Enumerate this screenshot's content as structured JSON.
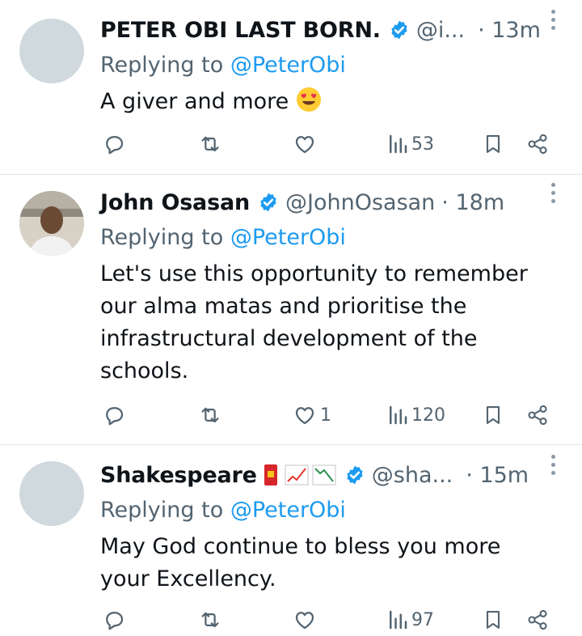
{
  "tweets": [
    {
      "name": "PETER OBI LAST BORN.",
      "handle": "@i...",
      "time": "· 13m",
      "replying_prefix": "Replying to",
      "replying_to": "@PeterObi",
      "text": "A giver and more",
      "emoji": "heart-eyes-emoji",
      "avatar": "placeholder",
      "likes": "",
      "views": "53"
    },
    {
      "name": "John Osasan",
      "handle": "@JohnOsasan",
      "time": "· 18m",
      "replying_prefix": "Replying to",
      "replying_to": "@PeterObi",
      "text": "Let's use this opportunity to remember our alma matas and prioritise the infrastructural development of the schools.",
      "avatar": "photo",
      "likes": "1",
      "views": "120"
    },
    {
      "name": "Shakespeare",
      "handle": "@sha...",
      "time": "· 15m",
      "replying_prefix": "Replying to",
      "replying_to": "@PeterObi",
      "text": "May God continue to bless you more your Excellency.",
      "name_emojis": [
        "red-envelope-emoji",
        "chart-increasing-emoji",
        "chart-decreasing-emoji"
      ],
      "avatar": "placeholder",
      "likes": "",
      "views": "97"
    }
  ],
  "colors": {
    "text": "#0f1419",
    "secondary": "#536471",
    "accent": "#1d9bf0",
    "divider": "#e3e7ea",
    "avatar": "#cfd9de"
  }
}
